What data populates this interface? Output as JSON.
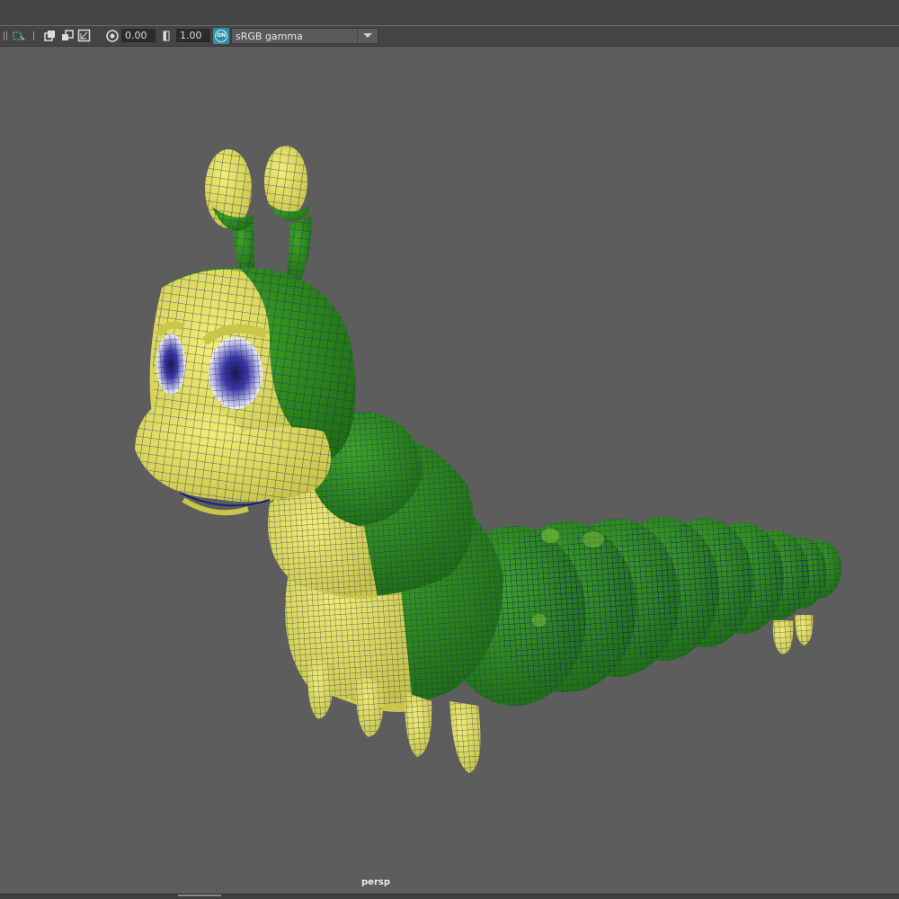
{
  "toolbar": {
    "exposure_value": "0.00",
    "gamma_value": "1.00",
    "color_management_badge": "ON",
    "color_space_selected": "sRGB gamma",
    "icons": [
      "grip-icon",
      "camera-select-icon",
      "frame-icon",
      "isolate-icon",
      "xray-icon",
      "exposure-icon",
      "gamma-icon",
      "color-management-icon",
      "dropdown-arrow-icon"
    ]
  },
  "viewport": {
    "camera_label": "persp",
    "background_color": "#5d5d5d",
    "model": {
      "subject": "caterpillar-model",
      "primary_color": "#e6e35c",
      "secondary_color": "#2f8a1c",
      "wireframe_color": "#16207a"
    }
  }
}
